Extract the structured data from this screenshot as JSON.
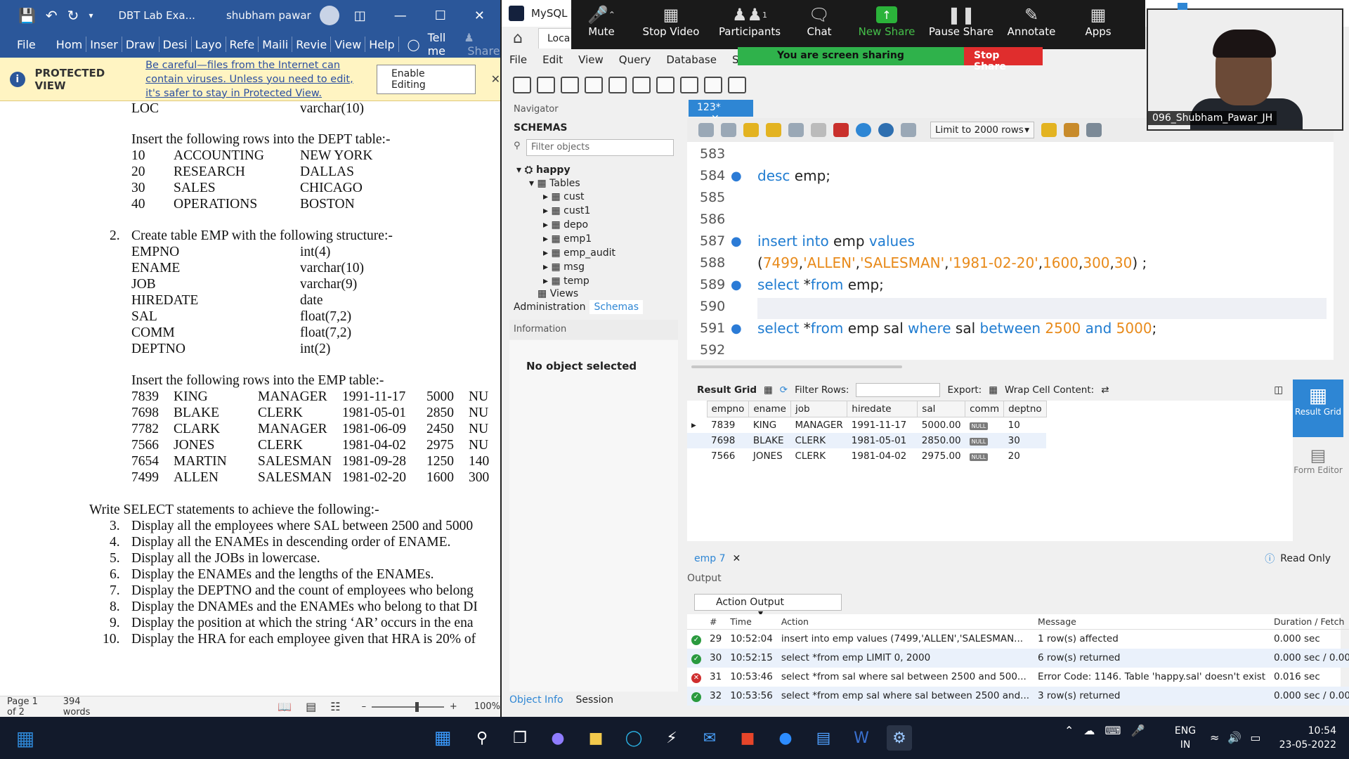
{
  "word": {
    "title": "DBT Lab Exa...",
    "user": "shubham pawar",
    "ribbon_file": "File",
    "ribbon": [
      "Hom",
      "Inser",
      "Draw",
      "Desi",
      "Layo",
      "Refe",
      "Maili",
      "Revie",
      "View",
      "Help"
    ],
    "tell_me": "Tell me",
    "share": "Share",
    "protected_label": "PROTECTED VIEW",
    "protected_msg": "Be careful—files from the Internet can contain viruses. Unless you need to edit, it's safer to stay in Protected View.",
    "enable_editing": "Enable Editing",
    "status_page": "Page 1 of 2",
    "status_words": "394 words",
    "zoom_level": "100%",
    "doc": {
      "loc_row": {
        "name": "LOC",
        "type": "varchar(10)"
      },
      "dept_insert": "Insert the following rows into the DEPT table:-",
      "dept_rows": [
        {
          "no": "10",
          "name": "ACCOUNTING",
          "loc": "NEW YORK"
        },
        {
          "no": "20",
          "name": "RESEARCH",
          "loc": "DALLAS"
        },
        {
          "no": "30",
          "name": "SALES",
          "loc": "CHICAGO"
        },
        {
          "no": "40",
          "name": "OPERATIONS",
          "loc": "BOSTON"
        }
      ],
      "emp_create_num": "2.",
      "emp_create": "Create table EMP with the following structure:-",
      "emp_struct": [
        {
          "name": "EMPNO",
          "type": "int(4)"
        },
        {
          "name": "ENAME",
          "type": "varchar(10)"
        },
        {
          "name": "JOB",
          "type": "varchar(9)"
        },
        {
          "name": "HIREDATE",
          "type": "date"
        },
        {
          "name": "SAL",
          "type": "float(7,2)"
        },
        {
          "name": "COMM",
          "type": "float(7,2)"
        },
        {
          "name": "DEPTNO",
          "type": "int(2)"
        }
      ],
      "emp_insert": "Insert the following rows into the EMP table:-",
      "emp_rows": [
        {
          "no": "7839",
          "name": "KING",
          "job": "MANAGER",
          "date": "1991-11-17",
          "sal": "5000",
          "tail": "NU"
        },
        {
          "no": "7698",
          "name": "BLAKE",
          "job": "CLERK",
          "date": "1981-05-01",
          "sal": "2850",
          "tail": "NU"
        },
        {
          "no": "7782",
          "name": "CLARK",
          "job": "MANAGER",
          "date": "1981-06-09",
          "sal": "2450",
          "tail": "NU"
        },
        {
          "no": "7566",
          "name": "JONES",
          "job": "CLERK",
          "date": "1981-04-02",
          "sal": "2975",
          "tail": "NU"
        },
        {
          "no": "7654",
          "name": "MARTIN",
          "job": "SALESMAN",
          "date": "1981-09-28",
          "sal": "1250",
          "tail": "140"
        },
        {
          "no": "7499",
          "name": "ALLEN",
          "job": "SALESMAN",
          "date": "1981-02-20",
          "sal": "1600",
          "tail": "300"
        }
      ],
      "select_intro": "Write SELECT statements to achieve the following:-",
      "tasks": [
        {
          "num": "3.",
          "text": "Display all the employees where SAL between 2500 and 5000"
        },
        {
          "num": "4.",
          "text": "Display all the ENAMEs in descending order of ENAME."
        },
        {
          "num": "5.",
          "text": "Display all the JOBs in lowercase."
        },
        {
          "num": "6.",
          "text": "Display the ENAMEs and the lengths of the ENAMEs."
        },
        {
          "num": "7.",
          "text": "Display the DEPTNO and the count of employees who belong"
        },
        {
          "num": "8.",
          "text": "Display the DNAMEs and the ENAMEs who belong to that DI"
        },
        {
          "num": "9.",
          "text": "Display the position at which the string ‘AR’ occurs in the ena"
        },
        {
          "num": "10.",
          "text": "Display the HRA for each employee given that HRA is 20% of"
        }
      ]
    }
  },
  "workbench": {
    "title": "MySQL W",
    "local_tab": "Loca",
    "menu": [
      "File",
      "Edit",
      "View",
      "Query",
      "Database",
      "Server"
    ],
    "navigator": "Navigator",
    "schemas": "SCHEMAS",
    "filter_placeholder": "Filter objects",
    "schema_name": "happy",
    "tables_label": "Tables",
    "tables": [
      "cust",
      "cust1",
      "depo",
      "emp1",
      "emp_audit",
      "msg",
      "temp"
    ],
    "views_label": "Views",
    "nav_tab_admin": "Administration",
    "nav_tab_schemas": "Schemas",
    "information": "Information",
    "no_object": "No object selected",
    "obj_info": "Object Info",
    "session": "Session",
    "editor_tab": "123*",
    "limit": "Limit to 2000 rows",
    "lines": [
      "583",
      "584",
      "585",
      "586",
      "587",
      "588",
      "589",
      "590",
      "591",
      "592"
    ],
    "result_grid_label": "Result Grid",
    "filter_rows": "Filter Rows:",
    "export": "Export:",
    "wrap": "Wrap Cell Content:",
    "side_result_grid": "Result Grid",
    "side_form_editor": "Form Editor",
    "result_tab": "emp 7",
    "read_only": "Read Only",
    "output_label": "Output",
    "action_output": "Action Output",
    "grid": {
      "headers": [
        "empno",
        "ename",
        "job",
        "hiredate",
        "sal",
        "comm",
        "deptno"
      ],
      "rows": [
        [
          "7839",
          "KING",
          "MANAGER",
          "1991-11-17",
          "5000.00",
          "NULL",
          "10"
        ],
        [
          "7698",
          "BLAKE",
          "CLERK",
          "1981-05-01",
          "2850.00",
          "NULL",
          "30"
        ],
        [
          "7566",
          "JONES",
          "CLERK",
          "1981-04-02",
          "2975.00",
          "NULL",
          "20"
        ]
      ]
    },
    "output": {
      "headers": [
        "",
        "#",
        "Time",
        "Action",
        "Message",
        "Duration / Fetch"
      ],
      "rows": [
        {
          "status": "ok",
          "n": "29",
          "time": "10:52:04",
          "action": "insert into emp values (7499,'ALLEN','SALESMAN...",
          "msg": "1 row(s) affected",
          "dur": "0.000 sec"
        },
        {
          "status": "ok",
          "n": "30",
          "time": "10:52:15",
          "action": "select *from emp LIMIT 0, 2000",
          "msg": "6 row(s) returned",
          "dur": "0.000 sec / 0.000 sec"
        },
        {
          "status": "err",
          "n": "31",
          "time": "10:53:46",
          "action": "select *from sal where sal between 2500 and 500...",
          "msg": "Error Code: 1146. Table 'happy.sal' doesn't exist",
          "dur": "0.016 sec"
        },
        {
          "status": "ok",
          "n": "32",
          "time": "10:53:56",
          "action": "select *from emp sal where sal between 2500 and...",
          "msg": "3 row(s) returned",
          "dur": "0.000 sec / 0.000 sec"
        }
      ]
    }
  },
  "zoom": {
    "buttons": [
      "Mute",
      "Stop Video",
      "Participants",
      "Chat",
      "New Share",
      "Pause Share",
      "Annotate",
      "Apps"
    ],
    "participants_count": "1",
    "sharing_msg": "You are screen sharing",
    "stop_share": "Stop Share",
    "video_label": "096_Shubham_Pawar_JH"
  },
  "taskbar": {
    "lang_top": "ENG",
    "lang_bottom": "IN",
    "time": "10:54",
    "date": "23-05-2022"
  },
  "colors": {
    "word_blue": "#2b579a",
    "protected_bg": "#fff4c2",
    "wb_accent": "#2e86d4",
    "zoom_green": "#2fb24b",
    "zoom_red": "#e02d2d",
    "sql_keyword": "#1f7cd1",
    "sql_literal": "#e88a1a"
  }
}
